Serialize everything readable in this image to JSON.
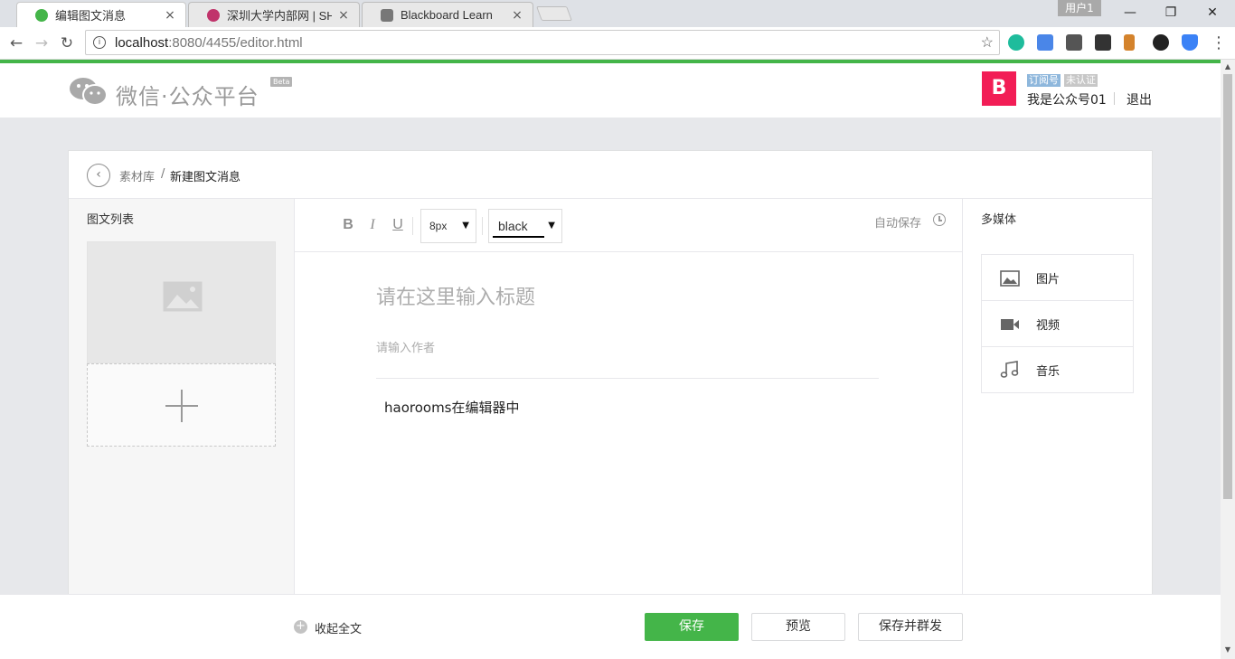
{
  "browser": {
    "tabs": [
      {
        "title": "编辑图文消息",
        "close": "×",
        "favicon_color": "#44b549"
      },
      {
        "title": "深圳大学内部网 | SHENZ",
        "close": "×",
        "favicon_color": "#c0336b"
      },
      {
        "title": "Blackboard Learn",
        "close": "×",
        "favicon_color": "#777777"
      }
    ],
    "profile_label": "用户1",
    "window_controls": {
      "minimize": "—",
      "restore": "❐",
      "close": "✕"
    },
    "nav": {
      "back": "←",
      "forward": "→",
      "reload": "↻"
    },
    "url": {
      "host": "localhost",
      "rest": ":8080/4455/editor.html"
    },
    "star_icon": "☆",
    "extensions": [
      {
        "name": "m-icon",
        "color": "#1ebc9c"
      },
      {
        "name": "translate-icon",
        "color": "#4a86e8"
      },
      {
        "name": "keep-icon",
        "color": "#555555"
      },
      {
        "name": "film-icon",
        "color": "#333333"
      },
      {
        "name": "tag-icon",
        "color": "#d4832c"
      },
      {
        "name": "color-wheel-icon",
        "color": "#222222"
      },
      {
        "name": "shield-icon",
        "color": "#3b82f6"
      }
    ],
    "menu_icon": "⋮",
    "accent_color": "#44b549"
  },
  "header": {
    "logo_text": "微信·公众平台",
    "beta_label": "Beta",
    "avatar_glyph": "B",
    "account_type": "订阅号",
    "account_status": "未认证",
    "account_name": "我是公众号01",
    "logout_label": "退出"
  },
  "breadcrumb": {
    "back_glyph": "‹",
    "link": "素材库",
    "separator": "/",
    "current": "新建图文消息"
  },
  "left_panel": {
    "title": "图文列表"
  },
  "editor": {
    "toolbar": {
      "bold": "B",
      "italic": "I",
      "underline": "U",
      "font_size": "8px",
      "font_color": "black",
      "caret": "▼",
      "autosave_label": "自动保存"
    },
    "title_placeholder": "请在这里输入标题",
    "author_placeholder": "请输入作者",
    "content_text": "haorooms在编辑器中"
  },
  "right_panel": {
    "title": "多媒体",
    "items": [
      {
        "label": "图片",
        "icon": "image-icon"
      },
      {
        "label": "视频",
        "icon": "video-icon"
      },
      {
        "label": "音乐",
        "icon": "music-icon"
      }
    ]
  },
  "footer": {
    "collapse_glyph": "+",
    "collapse_label": "收起全文",
    "save_label": "保存",
    "preview_label": "预览",
    "publish_label": "保存并群发"
  }
}
